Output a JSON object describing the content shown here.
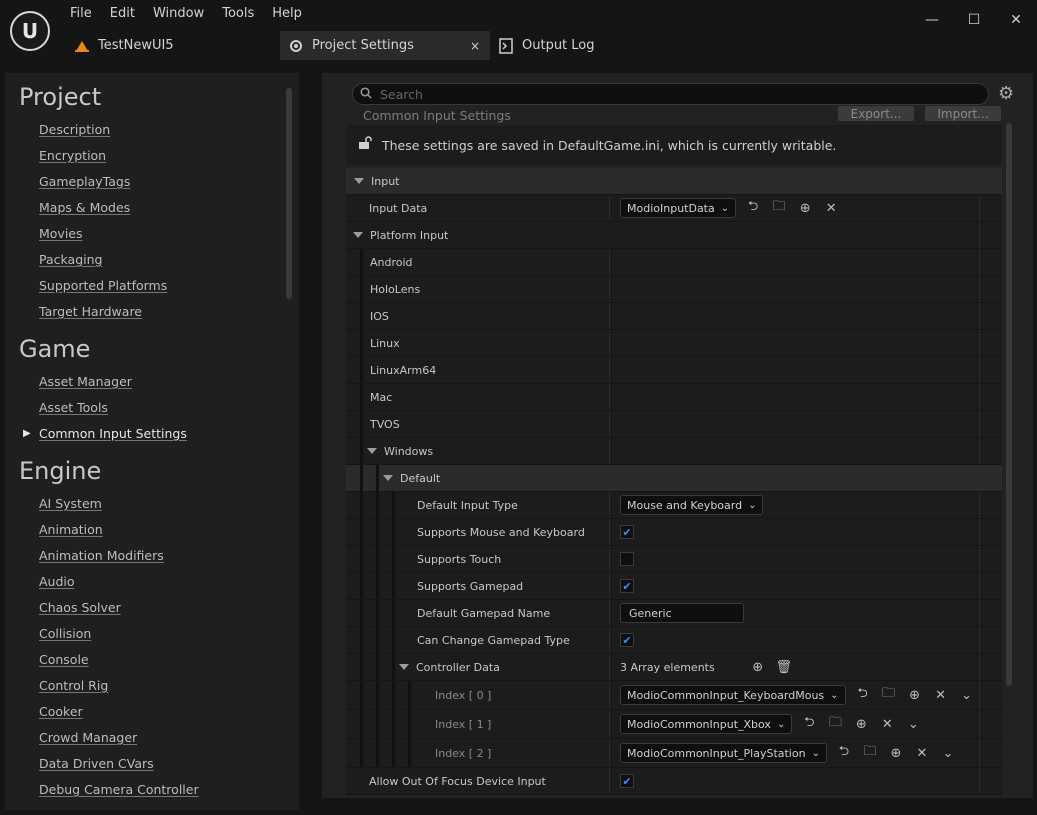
{
  "app": {
    "logo": "U"
  },
  "menu": [
    "File",
    "Edit",
    "Window",
    "Tools",
    "Help"
  ],
  "window_controls": {
    "minimize": "—",
    "maximize": "☐",
    "close": "✕"
  },
  "tabs": [
    {
      "label": "TestNewUI5",
      "icon": "ue-project-icon"
    },
    {
      "label": "Project Settings",
      "icon": "settings-icon",
      "close": "×"
    },
    {
      "label": "Output Log",
      "icon": "log-icon"
    }
  ],
  "sidebar": {
    "sections": [
      {
        "title": "Project",
        "items": [
          "Description",
          "Encryption",
          "GameplayTags",
          "Maps & Modes",
          "Movies",
          "Packaging",
          "Supported Platforms",
          "Target Hardware"
        ]
      },
      {
        "title": "Game",
        "items": [
          "Asset Manager",
          "Asset Tools",
          "Common Input Settings"
        ]
      },
      {
        "title": "Engine",
        "items": [
          "AI System",
          "Animation",
          "Animation Modifiers",
          "Audio",
          "Chaos Solver",
          "Collision",
          "Console",
          "Control Rig",
          "Cooker",
          "Crowd Manager",
          "Data Driven CVars",
          "Debug Camera Controller"
        ]
      }
    ],
    "selected": "Common Input Settings"
  },
  "search": {
    "placeholder": "Search"
  },
  "panel": {
    "category_title": "Common Input Settings",
    "export_label": "Export...",
    "import_label": "Import...",
    "writable_notice": "These settings are saved in DefaultGame.ini, which is currently writable."
  },
  "rows": {
    "input_header": "Input",
    "input_data": {
      "label": "Input Data",
      "value": "ModioInputData"
    },
    "platform_input": "Platform Input",
    "platforms": [
      "Android",
      "HoloLens",
      "IOS",
      "Linux",
      "LinuxArm64",
      "Mac",
      "TVOS",
      "Windows"
    ],
    "default": "Default",
    "default_input_type": {
      "label": "Default Input Type",
      "value": "Mouse and Keyboard"
    },
    "supports_mouse_keyboard": {
      "label": "Supports Mouse and Keyboard",
      "checked": true
    },
    "supports_touch": {
      "label": "Supports Touch",
      "checked": false
    },
    "supports_gamepad": {
      "label": "Supports Gamepad",
      "checked": true
    },
    "default_gamepad_name": {
      "label": "Default Gamepad Name",
      "value": "Generic"
    },
    "can_change_gamepad_type": {
      "label": "Can Change Gamepad Type",
      "checked": true
    },
    "controller_data": {
      "label": "Controller Data",
      "value": "3 Array elements"
    },
    "controller_items": [
      {
        "label": "Index [ 0 ]",
        "value": "ModioCommonInput_KeyboardMous"
      },
      {
        "label": "Index [ 1 ]",
        "value": "ModioCommonInput_Xbox"
      },
      {
        "label": "Index [ 2 ]",
        "value": "ModioCommonInput_PlayStation"
      }
    ],
    "allow_out_of_focus": {
      "label": "Allow Out Of Focus Device Input",
      "checked": true
    }
  },
  "colors": {
    "accent_check": "#3b8ef0",
    "background": "#151515",
    "panel": "#222222"
  }
}
